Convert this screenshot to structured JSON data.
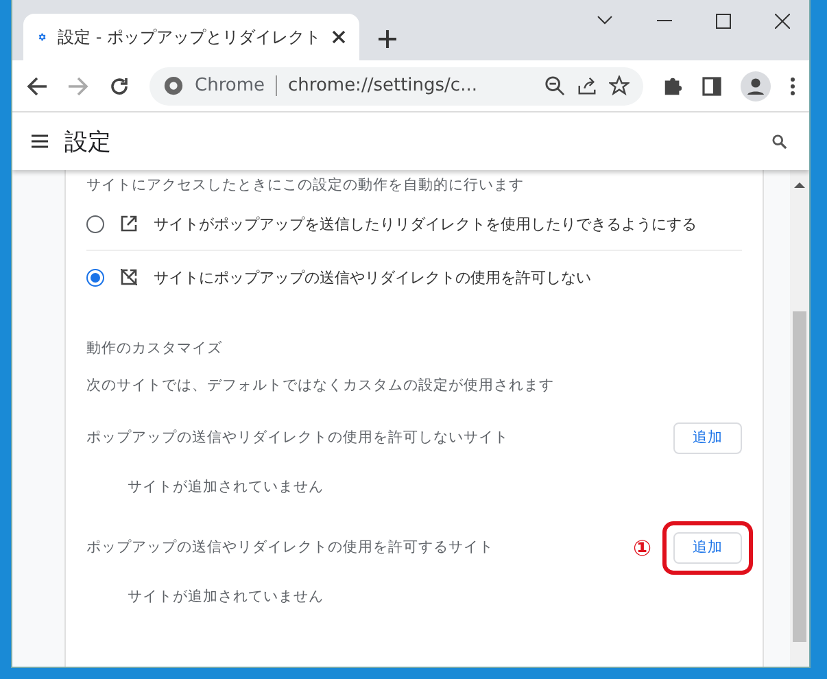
{
  "tab": {
    "title": "設定 - ポップアップとリダイレクト",
    "selected": true
  },
  "toolbar": {
    "chip": "Chrome",
    "url": "chrome://settings/c..."
  },
  "header": {
    "title": "設定"
  },
  "intro": "サイトにアクセスしたときにこの設定の動作を自動的に行います",
  "options": [
    {
      "kind": "allow",
      "label": "サイトがポップアップを送信したりリダイレクトを使用したりできるようにする",
      "selected": false
    },
    {
      "kind": "block",
      "label": "サイトにポップアップの送信やリダイレクトの使用を許可しない",
      "selected": true
    }
  ],
  "custom": {
    "title": "動作のカスタマイズ",
    "description": "次のサイトでは、デフォルトではなくカスタムの設定が使用されます"
  },
  "site_lists": [
    {
      "label": "ポップアップの送信やリダイレクトの使用を許可しないサイト",
      "button": "追加",
      "empty": "サイトが追加されていません",
      "highlighted": false
    },
    {
      "label": "ポップアップの送信やリダイレクトの使用を許可するサイト",
      "button": "追加",
      "empty": "サイトが追加されていません",
      "highlighted": true,
      "annotation": "①"
    }
  ]
}
